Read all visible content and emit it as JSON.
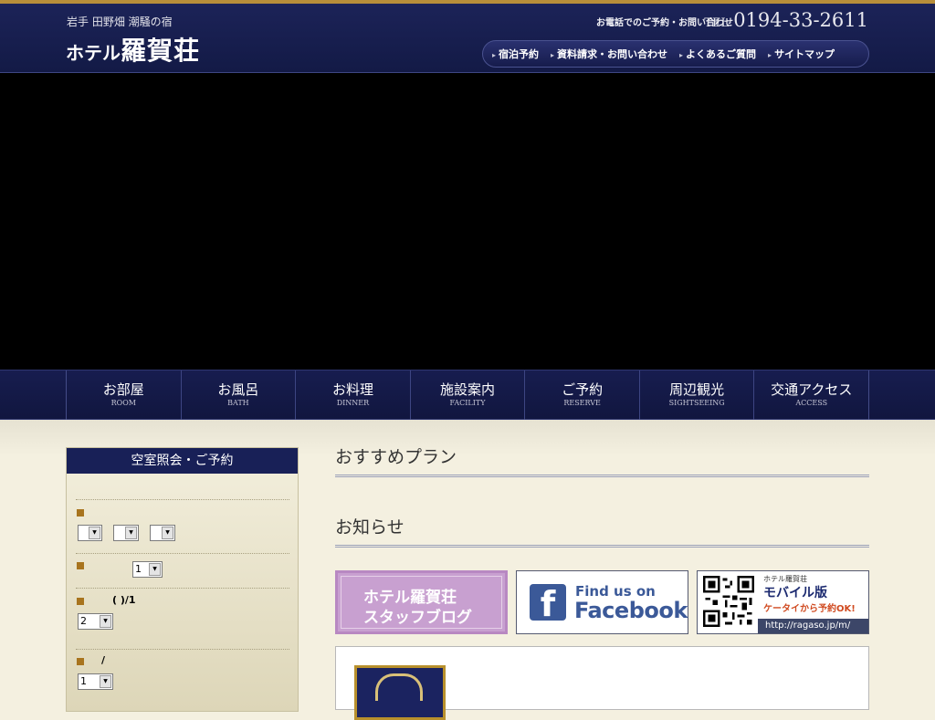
{
  "header": {
    "tagline": "岩手 田野畑 潮騒の宿",
    "logo_small": "ホテル",
    "logo_big": "羅賀荘",
    "contact_label": "お電話でのご予約・お問い合わせ",
    "tel_label": "TEL",
    "tel_number": "0194-33-2611"
  },
  "utility_nav": [
    {
      "label": "宿泊予約"
    },
    {
      "label": "資料請求・お問い合わせ"
    },
    {
      "label": "よくあるご質問"
    },
    {
      "label": "サイトマップ"
    }
  ],
  "global_nav": [
    {
      "ja": "お部屋",
      "en": "ROOM"
    },
    {
      "ja": "お風呂",
      "en": "BATH"
    },
    {
      "ja": "お料理",
      "en": "DINNER"
    },
    {
      "ja": "施設案内",
      "en": "FACILITY"
    },
    {
      "ja": "ご予約",
      "en": "RESERVE"
    },
    {
      "ja": "周辺観光",
      "en": "SIGHTSEEING"
    },
    {
      "ja": "交通アクセス",
      "en": "ACCESS"
    }
  ],
  "reserve": {
    "title": "空室照会・ご予約",
    "rooms_value": "1",
    "persons_text": "(   )/1",
    "persons_value": "2",
    "slash_text": "/",
    "nights_value": "1"
  },
  "sections": {
    "recommended_title": "おすすめプラン",
    "news_title": "お知らせ"
  },
  "banners": {
    "blog_line1": "ホテル羅賀荘",
    "blog_line2": "スタッフブログ",
    "fb_line1": "Find us on",
    "fb_line2": "Facebook",
    "fb_logo": "f",
    "mobile_small": "ホテル羅賀荘",
    "mobile_title": "モバイル版",
    "mobile_sub": "ケータイから予約OK!",
    "mobile_url": "http://ragaso.jp/m/"
  },
  "icons": {
    "utility_arrow": "arrow-right-icon",
    "bullet": "square-bullet-icon",
    "dropdown": "chevron-down-icon"
  },
  "colors": {
    "navy": "#182057",
    "gold": "#b88e3a",
    "bullet": "#a8741e",
    "blog_purple": "#c8a0d0",
    "facebook_blue": "#3b5998"
  }
}
